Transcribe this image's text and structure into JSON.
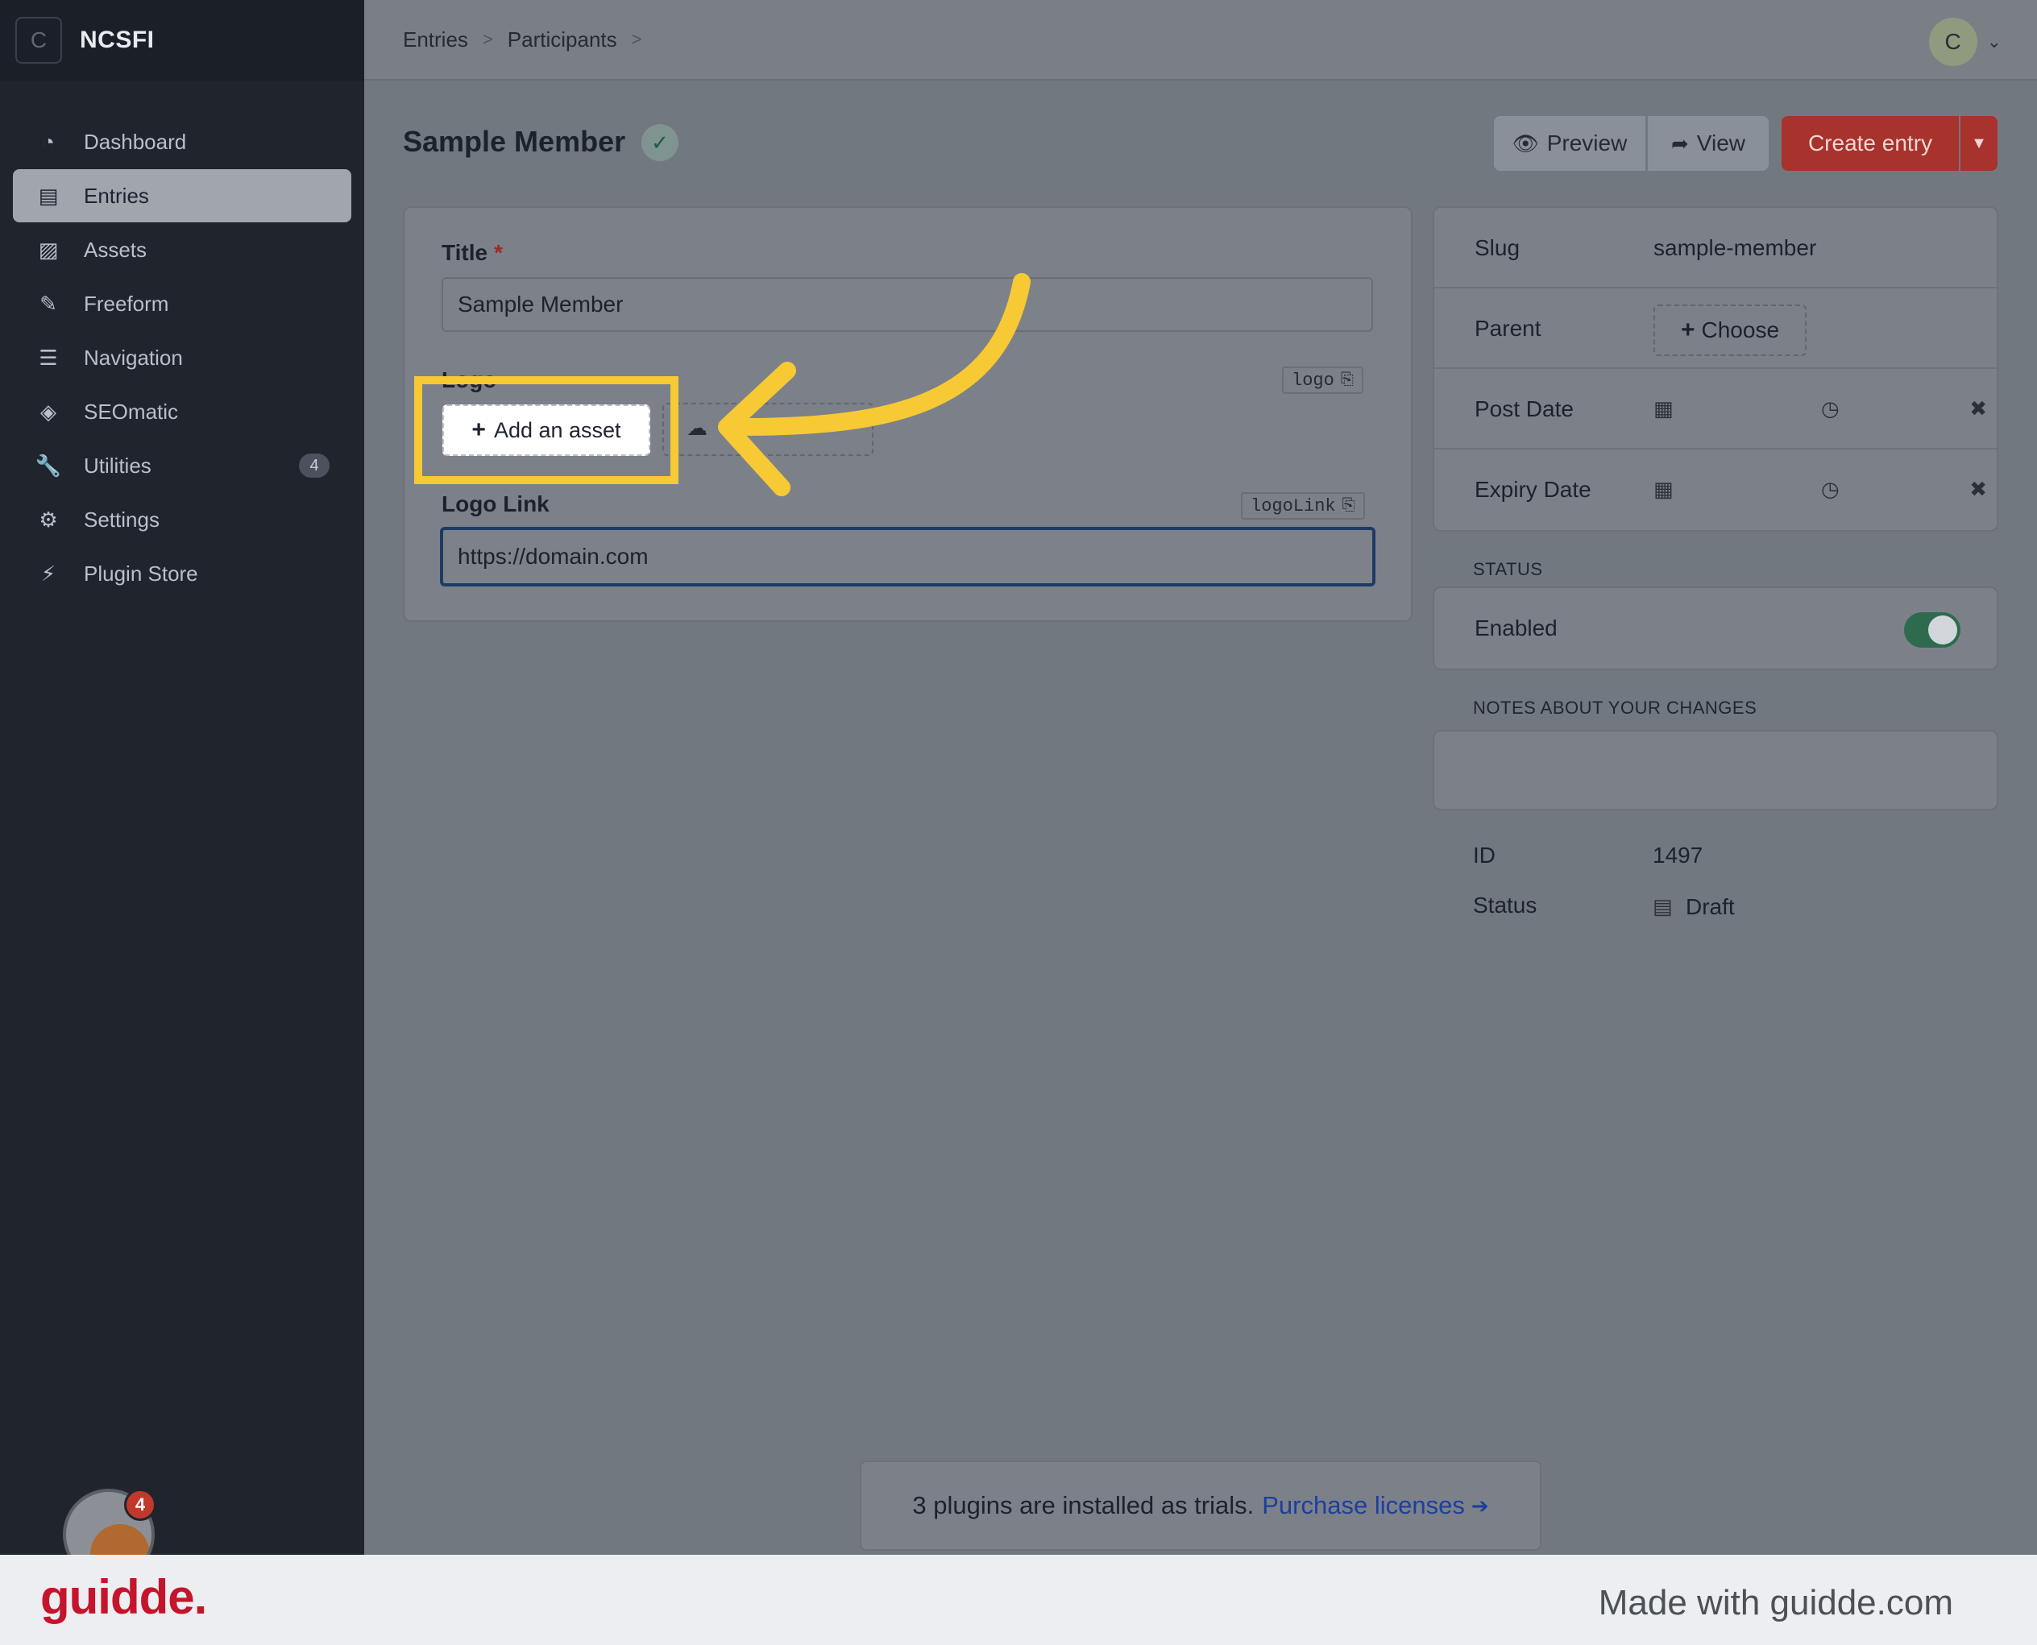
{
  "app": {
    "brand_initial": "C",
    "site_name": "NCSFI"
  },
  "sidebar": {
    "items": [
      {
        "label": "Dashboard",
        "icon": "dashboard-icon",
        "glyph": "◔"
      },
      {
        "label": "Entries",
        "icon": "entries-icon",
        "glyph": "▤",
        "active": true
      },
      {
        "label": "Assets",
        "icon": "assets-icon",
        "glyph": "▨"
      },
      {
        "label": "Freeform",
        "icon": "freeform-icon",
        "glyph": "✎"
      },
      {
        "label": "Navigation",
        "icon": "navigation-icon",
        "glyph": "☰"
      },
      {
        "label": "SEOmatic",
        "icon": "seomatic-icon",
        "glyph": "◈"
      },
      {
        "label": "Utilities",
        "icon": "wrench-icon",
        "glyph": "🔧",
        "badge": "4"
      },
      {
        "label": "Settings",
        "icon": "gear-icon",
        "glyph": "⚙"
      },
      {
        "label": "Plugin Store",
        "icon": "plug-icon",
        "glyph": "⚡"
      }
    ],
    "notification_badge": "4"
  },
  "header": {
    "breadcrumb": [
      "Entries",
      "Participants"
    ],
    "account_initial": "C"
  },
  "page": {
    "title": "Sample Member",
    "preview_label": "Preview",
    "view_label": "View",
    "create_label": "Create entry"
  },
  "form": {
    "title_label": "Title",
    "title_value": "Sample Member",
    "logo_label": "Logo",
    "logo_handle": "logo",
    "add_asset_label": "Add an asset",
    "logo_link_label": "Logo Link",
    "logo_link_handle": "logoLink",
    "logo_link_value": "https://domain.com"
  },
  "meta": {
    "slug_label": "Slug",
    "slug_value": "sample-member",
    "parent_label": "Parent",
    "choose_label": "Choose",
    "post_date_label": "Post Date",
    "expiry_date_label": "Expiry Date",
    "status_heading": "STATUS",
    "enabled_label": "Enabled",
    "enabled": true,
    "notes_heading": "NOTES ABOUT YOUR CHANGES",
    "id_label": "ID",
    "id_value": "1497",
    "status_label": "Status",
    "status_value": "Draft"
  },
  "notice": {
    "text": "3 plugins are installed as trials.",
    "link": "Purchase licenses"
  },
  "footer": {
    "logo": "guidde.",
    "made_with": "Made with guidde.com"
  },
  "colors": {
    "highlight": "#f7c934",
    "create_button": "#a8322c",
    "sidebar_bg": "#1f242d",
    "toggle_on": "#2e6b4e",
    "link": "#1b3f9e",
    "guidde_red": "#c4152d"
  }
}
